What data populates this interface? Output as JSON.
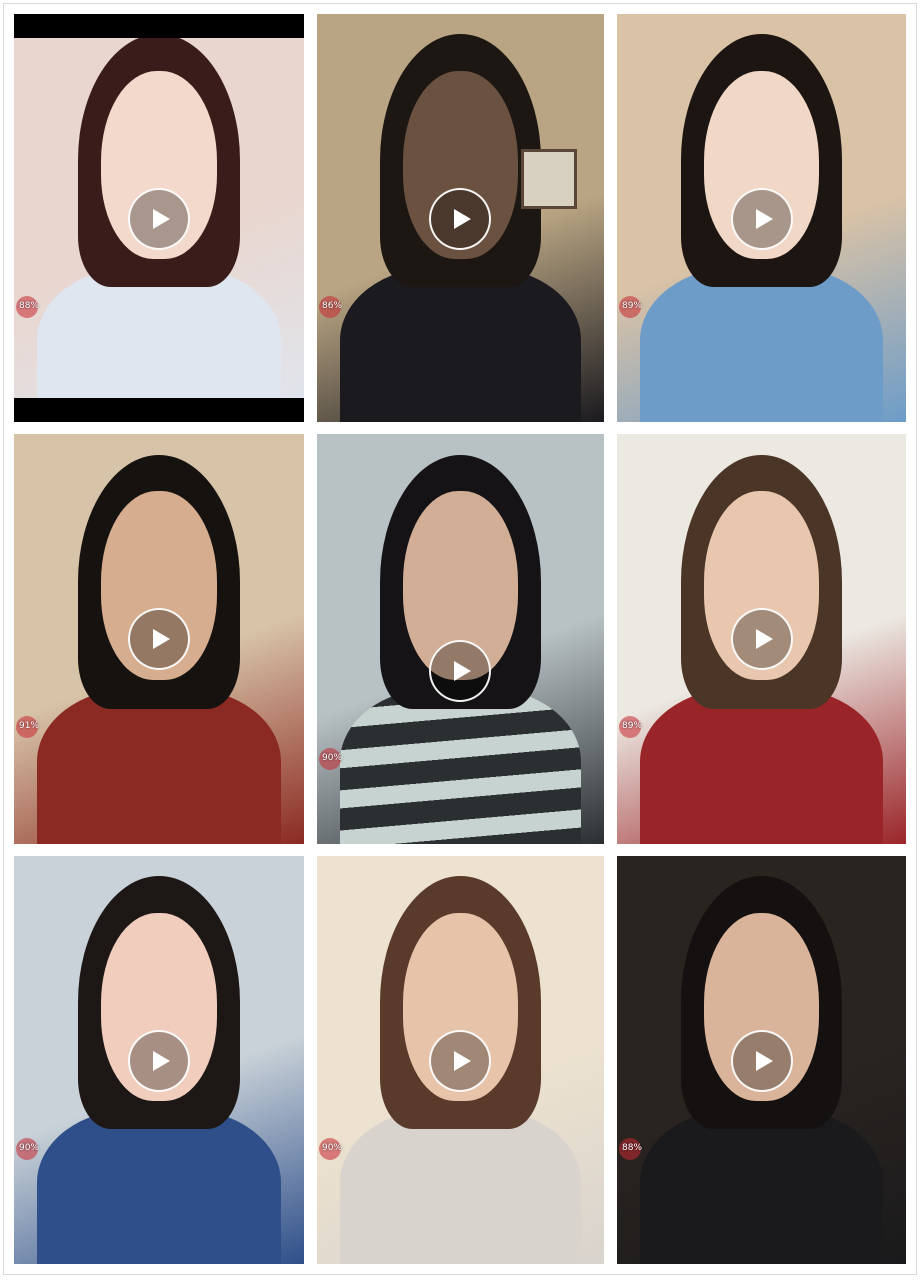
{
  "grid": {
    "tiles": [
      {
        "id": "t1",
        "percent": "88%",
        "palette": {
          "bg": "#e9d6cf",
          "hair": "#3a1d1a",
          "face": "#f3d9cc",
          "body": "#dfe6ef"
        },
        "letterbox": true
      },
      {
        "id": "t2",
        "percent": "86%",
        "palette": {
          "bg": "#b9a583",
          "hair": "#1c1713",
          "face": "#6b5140",
          "body": "#1b1a1f"
        },
        "letterbox": false,
        "picture": true
      },
      {
        "id": "t3",
        "percent": "89%",
        "palette": {
          "bg": "#d9c2a6",
          "hair": "#1c1512",
          "face": "#f1d7c6",
          "body": "#6d9cc8"
        },
        "letterbox": false
      },
      {
        "id": "t4",
        "percent": "91%",
        "palette": {
          "bg": "#d7c3a8",
          "hair": "#151210",
          "face": "#d6ad8f",
          "body": "#8b2a22"
        },
        "letterbox": false
      },
      {
        "id": "t5",
        "percent": "90%",
        "palette": {
          "bg": "#b8c1c4",
          "hair": "#151315",
          "face": "#d2ae96",
          "body": "#2b2f32"
        },
        "letterbox": false,
        "stripes": true
      },
      {
        "id": "t6",
        "percent": "89%",
        "palette": {
          "bg": "#ece8e2",
          "hair": "#4b3526",
          "face": "#e8c7ae",
          "body": "#9a2529"
        },
        "letterbox": false
      },
      {
        "id": "t7",
        "percent": "90%",
        "palette": {
          "bg": "#c9d2d8",
          "hair": "#1d1716",
          "face": "#f0cdbd",
          "body": "#2f4f8a"
        },
        "letterbox": false
      },
      {
        "id": "t8",
        "percent": "90%",
        "palette": {
          "bg": "#ede2cf",
          "hair": "#5a3b2b",
          "face": "#e7c3aa",
          "body": "#d8d3cd"
        },
        "letterbox": false
      },
      {
        "id": "t9",
        "percent": "88%",
        "palette": {
          "bg": "#2a2420",
          "hair": "#141110",
          "face": "#d9b49a",
          "body": "#1a1a1c"
        },
        "letterbox": false
      }
    ]
  },
  "icons": {
    "play": "play-icon",
    "percent_badge": "circle-badge"
  }
}
